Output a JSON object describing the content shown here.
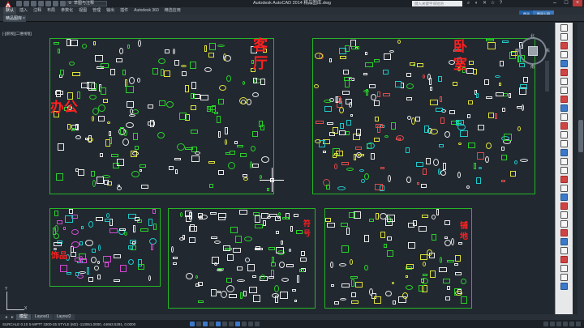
{
  "app": {
    "window_title": "Autodesk AutoCAD 2014    精品图库.dwg",
    "logo": "A",
    "workspace": "草图与注释",
    "search_placeholder": "键入关键字或短语",
    "sign_in": "登录",
    "sign_in_badge": "登录上网"
  },
  "ribbon": {
    "tabs": [
      "默认",
      "插入",
      "注释",
      "布局",
      "参数化",
      "视图",
      "管理",
      "输出",
      "插件",
      "Autodesk 360",
      "精选应用"
    ],
    "active_index": 0
  },
  "document": {
    "tab_label": "精品图库",
    "viewport_label": "[-][俯视][二维线框]"
  },
  "frames": [
    {
      "id": "living-office",
      "labels": [
        "客",
        "厅",
        "办公"
      ]
    },
    {
      "id": "bedroom",
      "labels": [
        "卧",
        "室"
      ]
    },
    {
      "id": "decor",
      "labels": [
        "饰品"
      ]
    },
    {
      "id": "symbols",
      "labels": [
        "符",
        "号"
      ]
    },
    {
      "id": "paving",
      "labels": [
        "铺",
        "地"
      ]
    }
  ],
  "viewcube": {
    "top": "上",
    "n": "北",
    "s": "南",
    "e": "东",
    "w": "西"
  },
  "ucs": {
    "x": "X",
    "y": "Y"
  },
  "layout_tabs": {
    "arrows": [
      "◄",
      "►"
    ],
    "model": "模型",
    "layout1": "Layout1",
    "layout2": "Layout2"
  },
  "status": {
    "coords": "SURCALE 0.10 S-MPTT 3300-25 STYLE (M2)  -113061.0000, 44663.5391, 0.0000"
  },
  "colors": {
    "background": "#212830",
    "frame": "#25b625",
    "label": "#ff2020"
  }
}
